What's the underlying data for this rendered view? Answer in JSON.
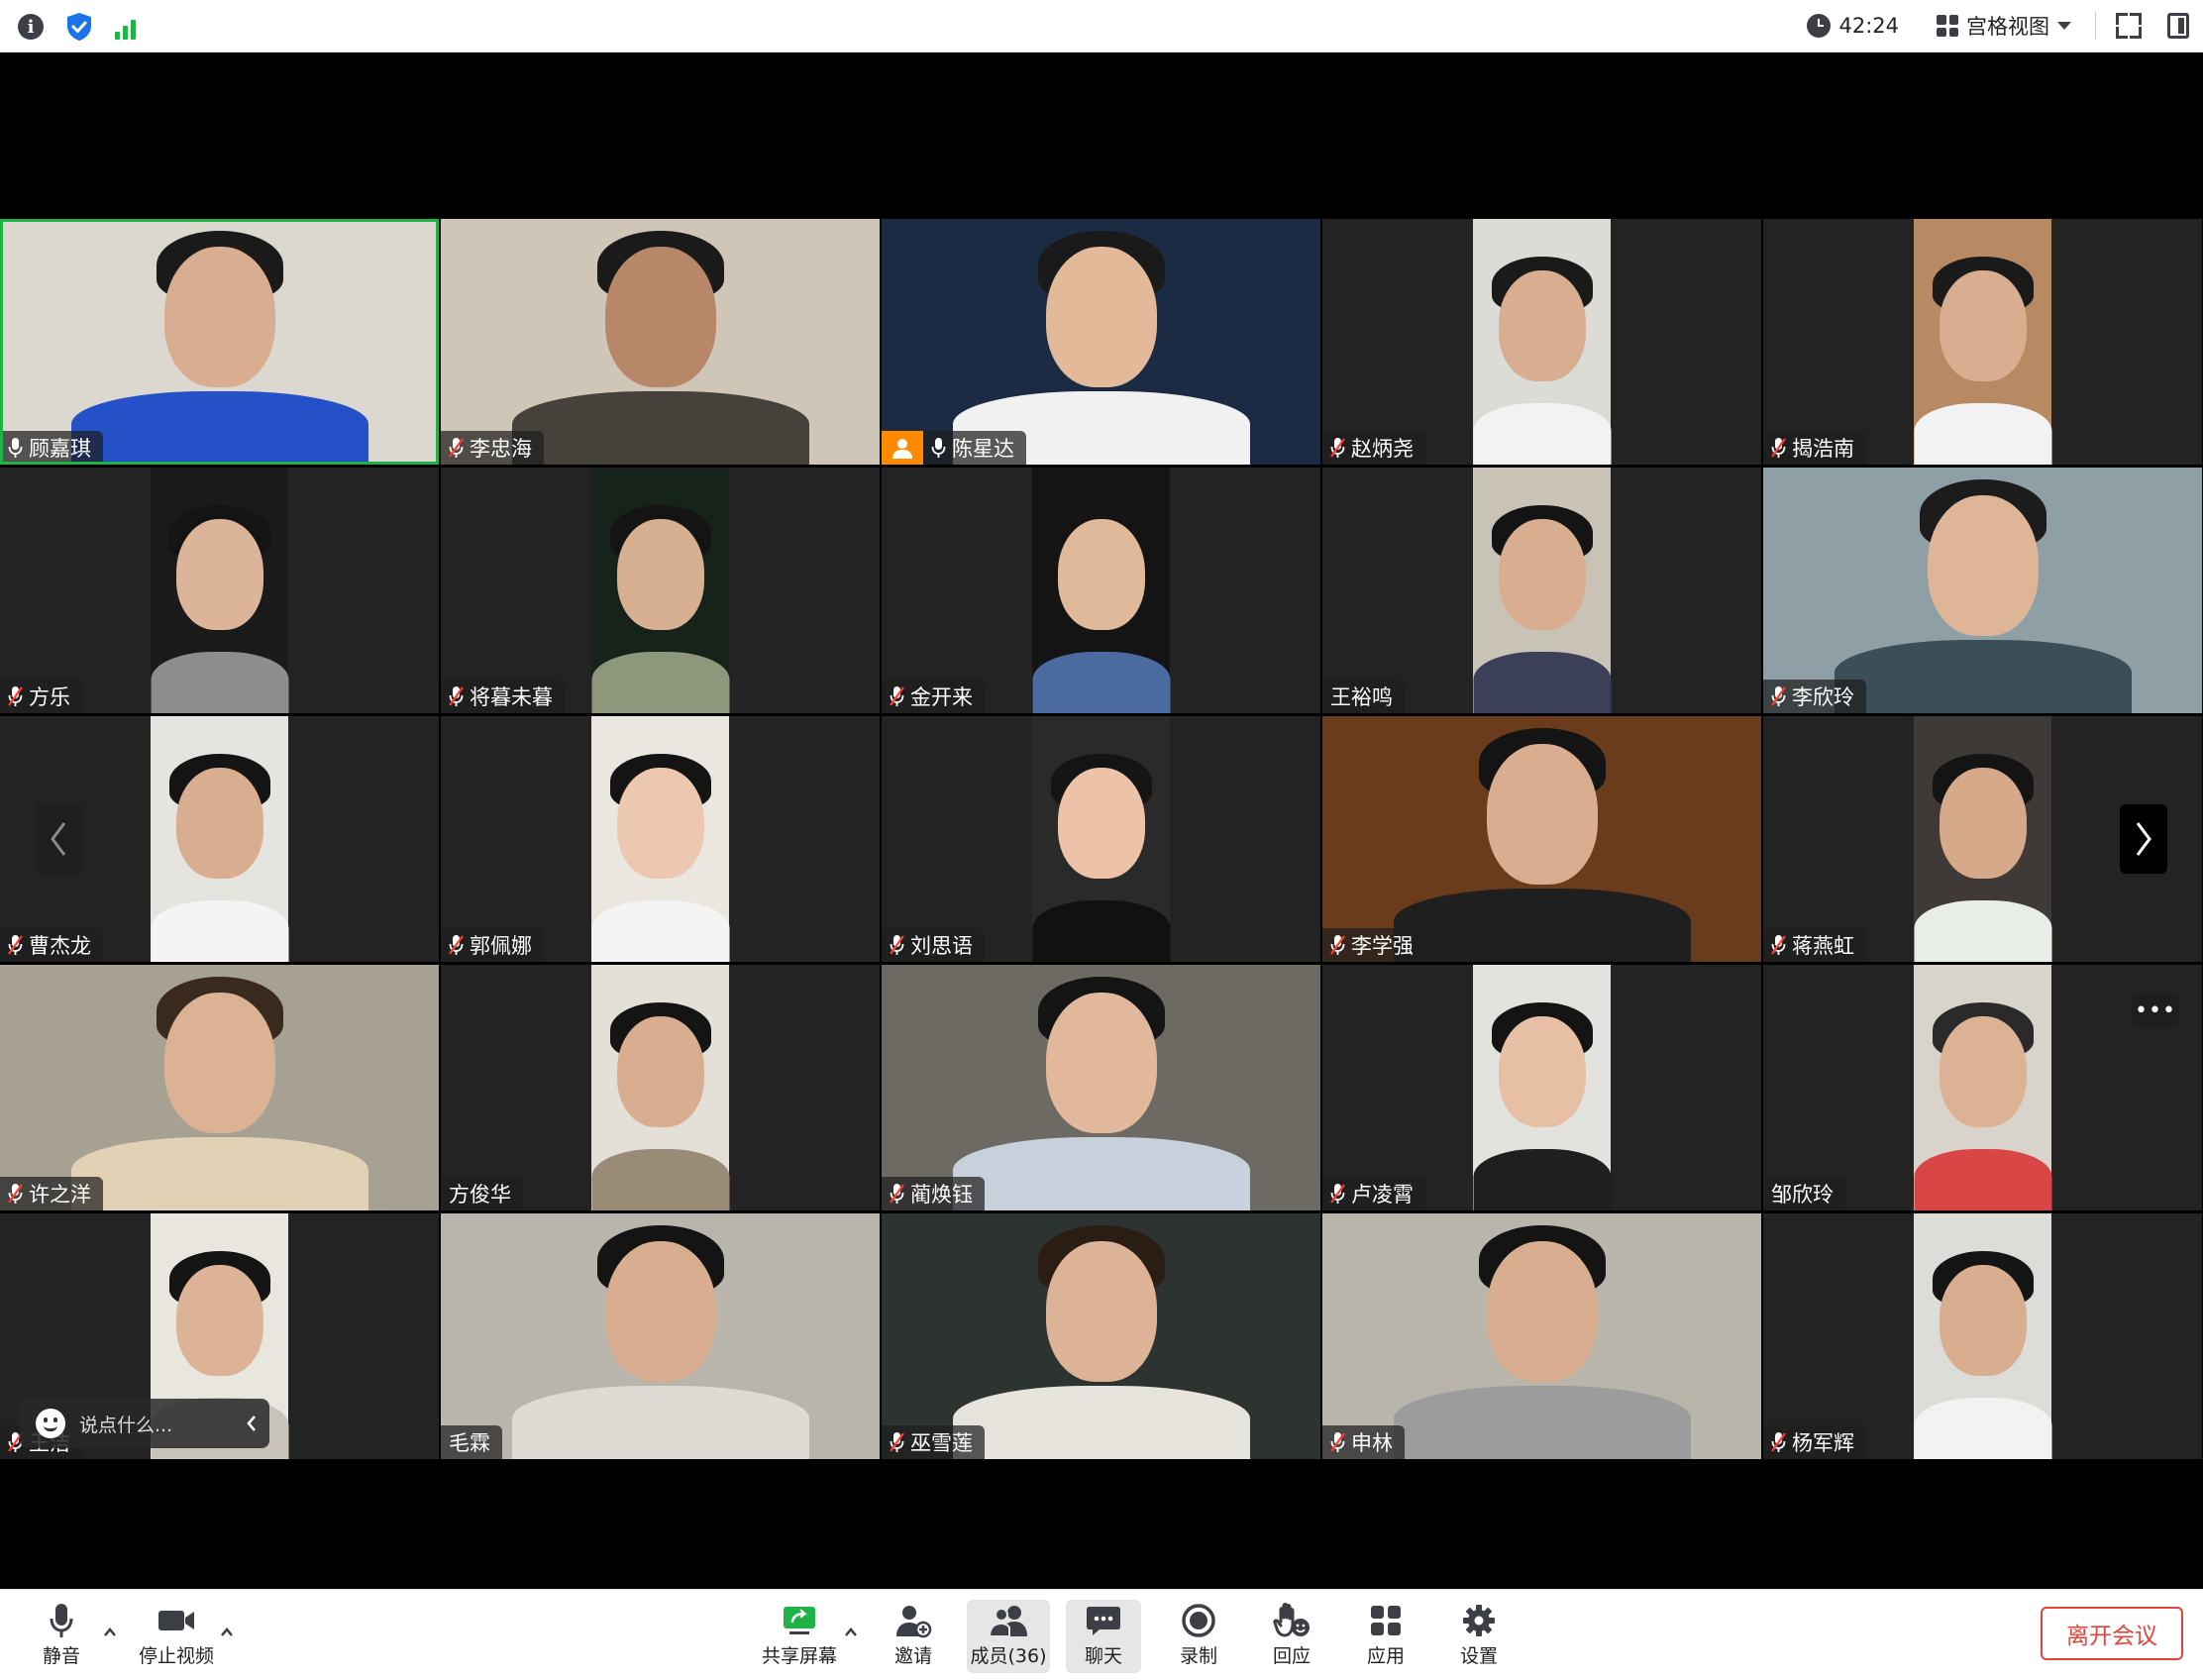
{
  "topbar": {
    "timer": "42:24",
    "view_label": "宫格视图"
  },
  "participants": [
    {
      "name": "顾嘉琪",
      "muted": false,
      "active": true,
      "host": false,
      "video": "full",
      "bg": "#dcd7cf",
      "shirt": "#2451c8",
      "skin": "#d9ad8f",
      "hair": "#1a1a1a"
    },
    {
      "name": "李忠海",
      "muted": true,
      "active": false,
      "host": false,
      "video": "full",
      "bg": "#cfc6b8",
      "shirt": "#45413b",
      "skin": "#b8876a",
      "hair": "#1a1a1a"
    },
    {
      "name": "陈星达",
      "muted": false,
      "active": false,
      "host": true,
      "video": "full",
      "bg": "#1c2b44",
      "shirt": "#f1f1f1",
      "skin": "#e2b999",
      "hair": "#1a1a1a"
    },
    {
      "name": "赵炳尧",
      "muted": true,
      "active": false,
      "host": false,
      "video": "portrait",
      "bg": "#dcdcd6",
      "shirt": "#f2f2f2",
      "skin": "#d9ad8f",
      "hair": "#1a1a1a"
    },
    {
      "name": "揭浩南",
      "muted": true,
      "active": false,
      "host": false,
      "video": "portrait",
      "bg": "#b88a63",
      "shirt": "#f2f2f2",
      "skin": "#d9ad8f",
      "hair": "#1a1a1a"
    },
    {
      "name": "方乐",
      "muted": true,
      "active": false,
      "host": false,
      "video": "portrait",
      "bg": "#1a1a1a",
      "shirt": "#8d8d8d",
      "skin": "#dcb499",
      "hair": "#141414"
    },
    {
      "name": "将暮未暮",
      "muted": true,
      "active": false,
      "host": false,
      "video": "portrait",
      "bg": "#16231a",
      "shirt": "#8e977c",
      "skin": "#d7b091",
      "hair": "#141414"
    },
    {
      "name": "金开来",
      "muted": true,
      "active": false,
      "host": false,
      "video": "portrait",
      "bg": "#141414",
      "shirt": "#4a6aa0",
      "skin": "#e0b89a",
      "hair": "#141414"
    },
    {
      "name": "王裕鸣",
      "muted": false,
      "active": false,
      "host": false,
      "video": "portrait",
      "bg": "#c9c2b6",
      "shirt": "#3b3f58",
      "skin": "#d9ad8f",
      "hair": "#141414"
    },
    {
      "name": "李欣玲",
      "muted": true,
      "active": false,
      "host": false,
      "video": "full",
      "bg": "#8ea0a6",
      "shirt": "#3b4f58",
      "skin": "#dfb597",
      "hair": "#1c1c1c"
    },
    {
      "name": "曹杰龙",
      "muted": true,
      "active": false,
      "host": false,
      "video": "portrait",
      "bg": "#e6e4de",
      "shirt": "#f4f4f4",
      "skin": "#d9ad8f",
      "hair": "#141414"
    },
    {
      "name": "郭佩娜",
      "muted": true,
      "active": false,
      "host": false,
      "video": "portrait",
      "bg": "#ebe6df",
      "shirt": "#f4f4f4",
      "skin": "#ecc8b0",
      "hair": "#141414"
    },
    {
      "name": "刘思语",
      "muted": true,
      "active": false,
      "host": false,
      "video": "portrait",
      "bg": "#2a2a2a",
      "shirt": "#111111",
      "skin": "#ecc3a8",
      "hair": "#141414"
    },
    {
      "name": "李学强",
      "muted": true,
      "active": false,
      "host": false,
      "video": "full",
      "bg": "#6b3c1c",
      "shirt": "#1f1f1f",
      "skin": "#d9ad8f",
      "hair": "#141414"
    },
    {
      "name": "蒋燕虹",
      "muted": true,
      "active": false,
      "host": false,
      "video": "portrait",
      "bg": "#3f3a38",
      "shirt": "#e8eee6",
      "skin": "#d6a98a",
      "hair": "#141414"
    },
    {
      "name": "许之洋",
      "muted": true,
      "active": false,
      "host": false,
      "video": "full",
      "bg": "#a7a194",
      "shirt": "#e2d2b5",
      "skin": "#dbb293",
      "hair": "#3a2a1e"
    },
    {
      "name": "方俊华",
      "muted": false,
      "active": false,
      "host": false,
      "video": "portrait",
      "bg": "#e4e0d8",
      "shirt": "#9a8a78",
      "skin": "#d9ad8f",
      "hair": "#141414"
    },
    {
      "name": "蔺焕钰",
      "muted": true,
      "active": false,
      "host": false,
      "video": "full",
      "bg": "#6d6a63",
      "shirt": "#c8d0dc",
      "skin": "#e2b89c",
      "hair": "#141414"
    },
    {
      "name": "卢凌霄",
      "muted": true,
      "active": false,
      "host": false,
      "video": "portrait",
      "bg": "#e2e2de",
      "shirt": "#1f1f1f",
      "skin": "#e6bfa5",
      "hair": "#141414"
    },
    {
      "name": "邹欣玲",
      "muted": false,
      "active": false,
      "host": false,
      "video": "portrait",
      "bg": "#d8d4cc",
      "shirt": "#d94646",
      "skin": "#dbb293",
      "hair": "#2a2a2a"
    },
    {
      "name": "王洁",
      "muted": true,
      "active": false,
      "host": false,
      "video": "portrait",
      "bg": "#e9e6df",
      "shirt": "#c9c2b8",
      "skin": "#dcb396",
      "hair": "#141414"
    },
    {
      "name": "毛霖",
      "muted": false,
      "active": false,
      "host": false,
      "video": "full",
      "bg": "#b9b5ad",
      "shirt": "#dedbd4",
      "skin": "#d9ad8f",
      "hair": "#141414"
    },
    {
      "name": "巫雪莲",
      "muted": true,
      "active": false,
      "host": false,
      "video": "full",
      "bg": "#2d3330",
      "shirt": "#e6e3dd",
      "skin": "#dcb396",
      "hair": "#2a1d14"
    },
    {
      "name": "申林",
      "muted": true,
      "active": false,
      "host": false,
      "video": "full",
      "bg": "#bab5ab",
      "shirt": "#9c9c9c",
      "skin": "#d9ad8f",
      "hair": "#141414"
    },
    {
      "name": "杨军辉",
      "muted": true,
      "active": false,
      "host": false,
      "video": "portrait",
      "bg": "#dcdcd8",
      "shirt": "#f2f2f2",
      "skin": "#d9ad8f",
      "hair": "#141414"
    }
  ],
  "chat": {
    "placeholder": "说点什么..."
  },
  "toolbar": {
    "mute_label": "静音",
    "video_label": "停止视频",
    "share_label": "共享屏幕",
    "invite_label": "邀请",
    "members_label": "成员(36)",
    "chat_label": "聊天",
    "record_label": "录制",
    "react_label": "回应",
    "apps_label": "应用",
    "settings_label": "设置",
    "leave_label": "离开会议"
  },
  "colors": {
    "active_border": "#1fb346",
    "host_badge": "#ff8a00",
    "leave": "#e0443a",
    "share_green": "#1fb346"
  }
}
